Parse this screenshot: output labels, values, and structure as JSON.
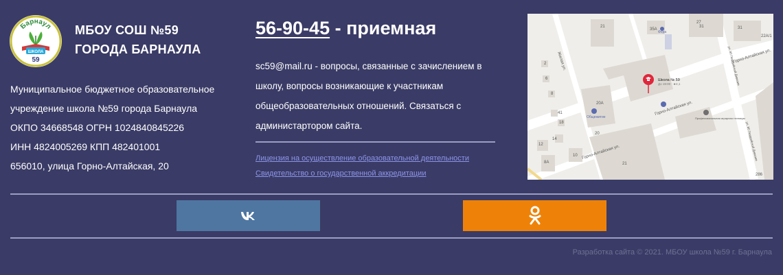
{
  "logo": {
    "arc_text": "Барнаул",
    "banner_text": "ШКОЛА",
    "number": "59"
  },
  "school": {
    "name_line1": "МБОУ СОШ №59",
    "name_line2": "ГОРОДА БАРНАУЛА",
    "info_lines": [
      "Муниципальное бюджетное образовательное",
      "учреждение школа №59 города Барнаула",
      "ОКПО 34668548 ОГРН 1024840845226",
      "ИНН 4824005269 КПП 482401001",
      "656010, улица Горно-Алтайская, 20"
    ]
  },
  "contact": {
    "phone": "56-90-45",
    "phone_suffix": " - приемная",
    "text_lines": [
      "sc59@mail.ru - вопросы, связанные с зачислением в",
      "школу, вопросы возникающие к участникам",
      "общеобразовательных отношений. Связаться с",
      "администартором сайта."
    ]
  },
  "links": {
    "license": "Лицензия на осуществление образовательной деятельности",
    "accreditation": "Свидетельство о государственной аккредитации"
  },
  "map": {
    "pin_title": "Школа № 59",
    "pin_subtitle": "До 19:00 · ★4,1",
    "labels": {
      "street_gorno": "Горно-Алтайская ул.",
      "street_gorno_2": "Горно-Алтайская ул.",
      "street_gorno_3": "Горно-Алтайская ул.",
      "street_zhilaya": "Жилая ул.",
      "street_gvard": "ул. 80 Гвардейской Дивизии",
      "street_gvard_2": "ул. 80 Гвардейской Дивизии",
      "dormitory": "Общежитие",
      "college": "Профессиональная аграрная техникум",
      "fora": "Фора",
      "b_21": "21",
      "b_35": "35А",
      "b_20a": "20А",
      "b_20": "20",
      "b_18": "18",
      "b_12": "12",
      "b_2": "2",
      "b_6": "6",
      "b_8": "8",
      "b_31": "31",
      "b_27": "27",
      "b_22a": "22А/1",
      "b_41": "41",
      "b_14": "14",
      "b_8a": "8А",
      "b_10": "10",
      "b_31b": "31",
      "b_21b": "21",
      "b_286": "286"
    }
  },
  "social": {
    "vk_label": "vk-icon",
    "ok_label": "ok-icon"
  },
  "colors": {
    "background": "#3a3b66",
    "vk": "#4e76a1",
    "ok": "#ee8208",
    "link": "#8d95ea",
    "pin": "#e0263a"
  },
  "footer": {
    "text": "Разработка сайта © 2021. МБОУ школа №59 г. Барнаула"
  }
}
